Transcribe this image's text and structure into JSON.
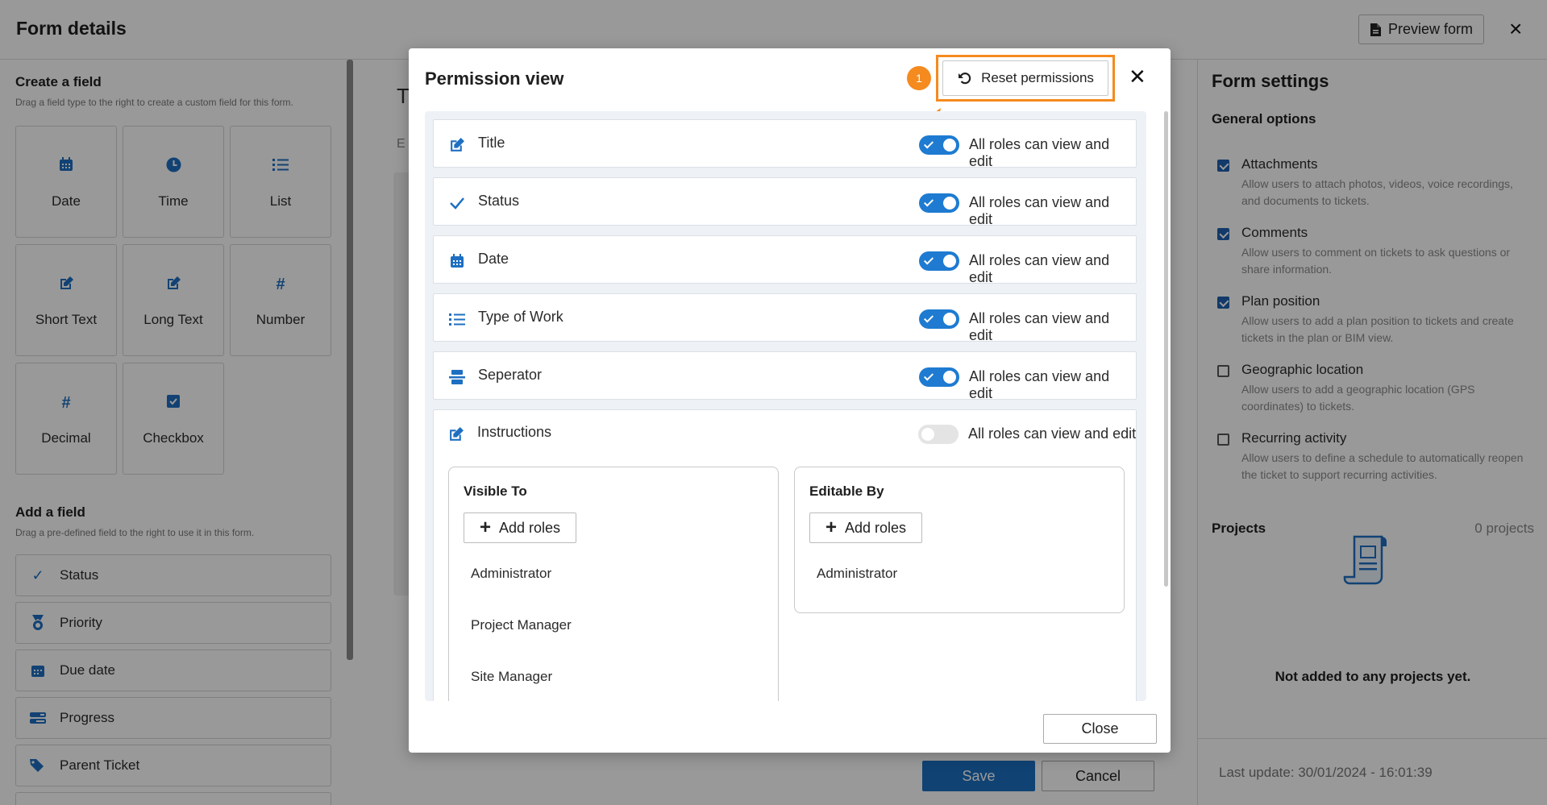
{
  "app": {
    "title": "Form details",
    "preview_label": "Preview form",
    "close_icon": "×"
  },
  "left": {
    "create_heading": "Create a field",
    "create_sub": "Drag a field type to the right to create a custom field for this form.",
    "tiles": [
      {
        "label": "Date",
        "icon": "calendar-icon"
      },
      {
        "label": "Time",
        "icon": "clock-icon"
      },
      {
        "label": "List",
        "icon": "list-icon"
      },
      {
        "label": "Short Text",
        "icon": "edit-icon"
      },
      {
        "label": "Long Text",
        "icon": "edit-icon"
      },
      {
        "label": "Number",
        "icon": "hash-icon"
      },
      {
        "label": "Decimal",
        "icon": "hash-icon"
      },
      {
        "label": "Checkbox",
        "icon": "checkbox-icon"
      }
    ],
    "add_heading": "Add a field",
    "add_sub": "Drag a pre-defined field to the right to use it in this form.",
    "predefined": [
      {
        "label": "Status",
        "icon": "check-icon"
      },
      {
        "label": "Priority",
        "icon": "medal-icon"
      },
      {
        "label": "Due date",
        "icon": "calendar-icon"
      },
      {
        "label": "Progress",
        "icon": "progress-icon"
      },
      {
        "label": "Parent Ticket",
        "icon": "tag-icon"
      }
    ]
  },
  "middle": {
    "title_fragment": "T",
    "desc_fragment": "E",
    "save_label": "Save",
    "cancel_label": "Cancel"
  },
  "right": {
    "heading": "Form settings",
    "general_heading": "General options",
    "options": [
      {
        "title": "Attachments",
        "desc": "Allow users to attach photos, videos, voice recordings, and documents to tickets.",
        "checked": true
      },
      {
        "title": "Comments",
        "desc": "Allow users to comment on tickets to ask questions or share information.",
        "checked": true
      },
      {
        "title": "Plan position",
        "desc": "Allow users to add a plan position to tickets and create tickets in the plan or BIM view.",
        "checked": true
      },
      {
        "title": "Geographic location",
        "desc": "Allow users to add a geographic location (GPS coordinates) to tickets.",
        "checked": false
      },
      {
        "title": "Recurring activity",
        "desc": "Allow users to define a schedule to automatically reopen the ticket to support recurring activities.",
        "checked": false
      }
    ],
    "projects_heading": "Projects",
    "projects_count": "0 projects",
    "projects_empty": "Not added to any projects yet.",
    "last_update": "Last update: 30/01/2024 - 16:01:39"
  },
  "modal": {
    "title": "Permission view",
    "reset_label": "Reset permissions",
    "step_number": "1",
    "accent_color": "#f58a1f",
    "toggle_color": "#1e7bd1",
    "rows": [
      {
        "name": "Title",
        "icon": "edit-icon",
        "toggle_label": "All roles can view and edit",
        "on": true
      },
      {
        "name": "Status",
        "icon": "check-icon",
        "toggle_label": "All roles can view and edit",
        "on": true
      },
      {
        "name": "Date",
        "icon": "calendar-icon",
        "toggle_label": "All roles can view and edit",
        "on": true
      },
      {
        "name": "Type of Work",
        "icon": "list-icon",
        "toggle_label": "All roles can view and edit",
        "on": true
      },
      {
        "name": "Seperator",
        "icon": "separator-icon",
        "toggle_label": "All roles can view and edit",
        "on": true
      },
      {
        "name": "Instructions",
        "icon": "edit-icon",
        "toggle_label": "All roles can view and edit",
        "on": false
      }
    ],
    "visible_to": {
      "heading": "Visible To",
      "add_label": "Add roles",
      "roles": [
        "Administrator",
        "Project Manager",
        "Site Manager"
      ]
    },
    "editable_by": {
      "heading": "Editable By",
      "add_label": "Add roles",
      "roles": [
        "Administrator"
      ]
    },
    "close_label": "Close"
  }
}
